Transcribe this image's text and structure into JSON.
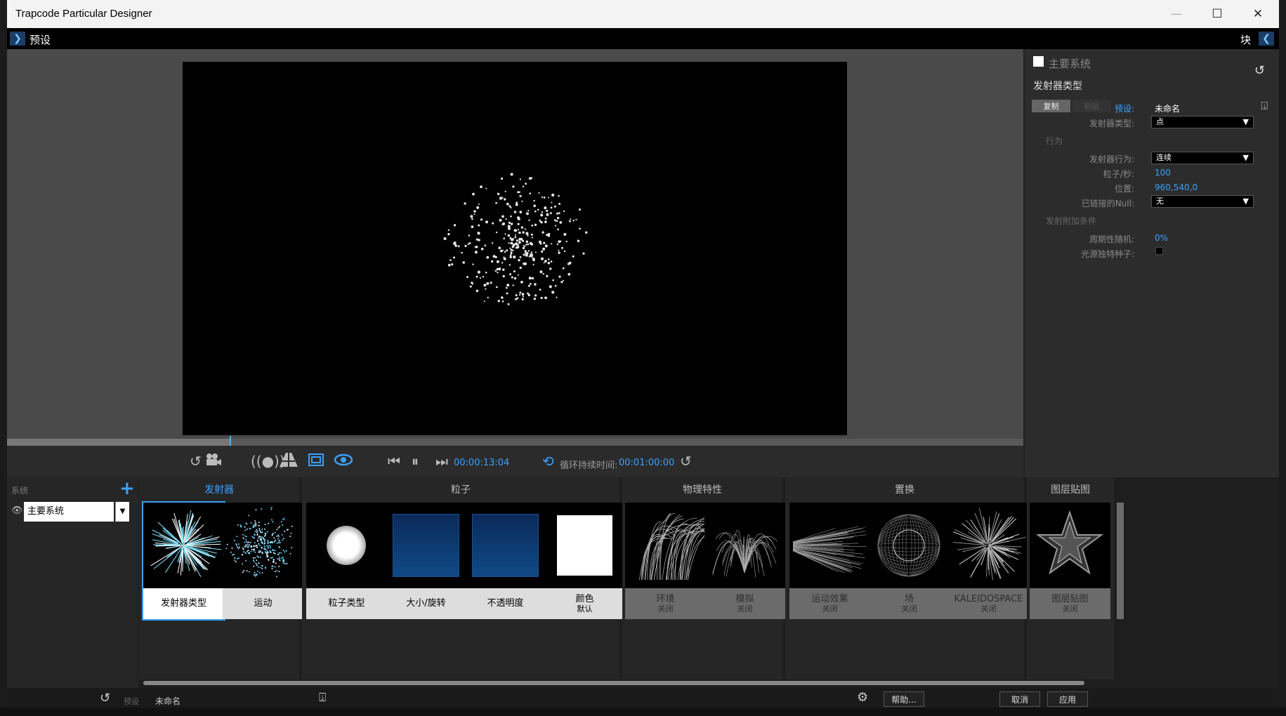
{
  "window": {
    "title": "Trapcode Particular Designer"
  },
  "menubar": {
    "left_label": "预设",
    "right_label": "块"
  },
  "transport": {
    "current_time": "00:00:13:04",
    "loop_label": "循环持续时间:",
    "loop_time": "00:01:00:00"
  },
  "right_panel": {
    "title": "主要系统",
    "subtitle": "发射器类型",
    "copy_label": "复制",
    "paste_label": "粘贴",
    "preset_label": "预设:",
    "preset_value": "未命名",
    "emitter_type_label": "发射器类型:",
    "emitter_type_value": "点",
    "behavior_section": "行为",
    "emitter_behavior_label": "发射器行为:",
    "emitter_behavior_value": "连续",
    "particles_per_sec_label": "粒子/秒:",
    "particles_per_sec_value": "100",
    "position_label": "位置:",
    "position_value": "960,540,0",
    "linked_null_label": "已链接的Null:",
    "linked_null_value": "无",
    "extra_section": "发射附加条件",
    "periodicity_label": "周期性随机:",
    "periodicity_value": "0%",
    "light_seed_label": "光源独特种子:"
  },
  "system_panel": {
    "header": "系统",
    "system_name": "主要系统"
  },
  "groups": [
    {
      "title": "发射器"
    },
    {
      "title": "粒子"
    },
    {
      "title": "物理特性"
    },
    {
      "title": "置换"
    },
    {
      "title": "图层贴图"
    }
  ],
  "tiles": [
    {
      "label": "发射器类型",
      "sub": ""
    },
    {
      "label": "运动",
      "sub": ""
    },
    {
      "label": "粒子类型",
      "sub": ""
    },
    {
      "label": "大小/旋转",
      "sub": ""
    },
    {
      "label": "不透明度",
      "sub": ""
    },
    {
      "label": "颜色",
      "sub": "默认"
    },
    {
      "label": "环境",
      "sub": "关闭"
    },
    {
      "label": "模拟",
      "sub": "关闭"
    },
    {
      "label": "运动效果",
      "sub": "关闭"
    },
    {
      "label": "场",
      "sub": "关闭"
    },
    {
      "label": "KALEIDOSPACE",
      "sub": "关闭"
    },
    {
      "label": "图层贴图",
      "sub": "关闭"
    }
  ],
  "statusbar": {
    "preset_label": "预设",
    "preset_value": "未命名",
    "help_label": "帮助...",
    "cancel_label": "取消",
    "apply_label": "应用"
  },
  "colors": {
    "accent": "#3aa0ff",
    "background": "#262626",
    "viewport": "#000000"
  }
}
